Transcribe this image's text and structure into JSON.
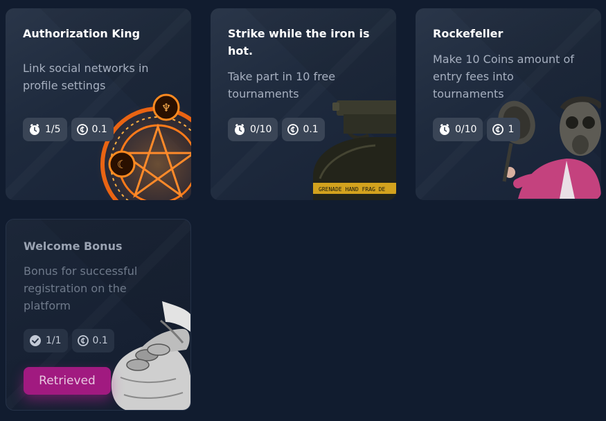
{
  "achievements": [
    {
      "title": "Authorization King",
      "description": "Link social networks in profile settings",
      "progress_text": "1/5",
      "progress_icon": "clock-icon",
      "reward": "0.1",
      "reward_icon": "coin-icon",
      "art": "pentagram-circle"
    },
    {
      "title": "Strike while the iron is hot.",
      "description": "Take part in 10 free tournaments",
      "progress_text": "0/10",
      "progress_icon": "clock-icon",
      "reward": "0.1",
      "reward_icon": "coin-icon",
      "art": "grenade",
      "art_label": "GRENADE HAND FRAG DE"
    },
    {
      "title": "Rockefeller",
      "description": "Make 10 Coins amount of entry fees into tournaments",
      "progress_text": "0/10",
      "progress_icon": "clock-icon",
      "reward": "1",
      "reward_icon": "coin-icon",
      "art": "gasmask-character-with-pan"
    },
    {
      "title": "Welcome Bonus",
      "description": "Bonus for successful registration on the platform",
      "progress_text": "1/1",
      "progress_icon": "check-icon",
      "reward": "0.1",
      "reward_icon": "coin-icon",
      "art": "money-bag",
      "button_label": "Retrieved"
    }
  ],
  "colors": {
    "background": "#111c2f",
    "card": "#1e2a3d",
    "chip": "#3a4556",
    "retrieved_button": "#a11a80"
  }
}
